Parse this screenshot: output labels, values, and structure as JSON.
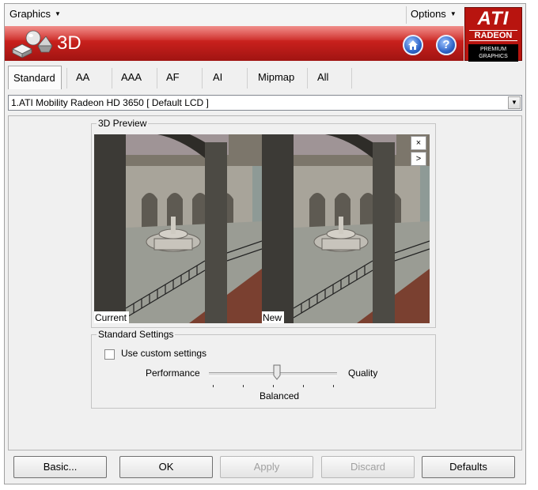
{
  "menus": {
    "graphics": "Graphics",
    "options": "Options"
  },
  "banner": {
    "title": "3D",
    "home_icon": "home-icon",
    "help_icon": "help-icon",
    "help_glyph": "?"
  },
  "logo": {
    "line1": "ATI",
    "line2": "RADEON",
    "line3": "PREMIUM",
    "line4": "GRAPHICS"
  },
  "tabs": [
    {
      "label": "Standard",
      "active": true
    },
    {
      "label": "AA"
    },
    {
      "label": "AAA"
    },
    {
      "label": "AF"
    },
    {
      "label": "AI"
    },
    {
      "label": "Mipmap"
    },
    {
      "label": "All"
    }
  ],
  "device": {
    "selected": "1.ATI Mobility Radeon HD 3650  [ Default LCD ]"
  },
  "preview": {
    "title": "3D Preview",
    "current_label": "Current",
    "new_label": "New",
    "close_glyph": "×",
    "next_glyph": ">"
  },
  "settings": {
    "title": "Standard Settings",
    "custom_label": "Use custom settings",
    "custom_checked": false,
    "left_label": "Performance",
    "right_label": "Quality",
    "value_label": "Balanced"
  },
  "buttons": {
    "basic": "Basic...",
    "ok": "OK",
    "apply": "Apply",
    "discard": "Discard",
    "defaults": "Defaults"
  },
  "colors": {
    "banner_red": "#c8201c",
    "logo_red": "#b8140f"
  }
}
